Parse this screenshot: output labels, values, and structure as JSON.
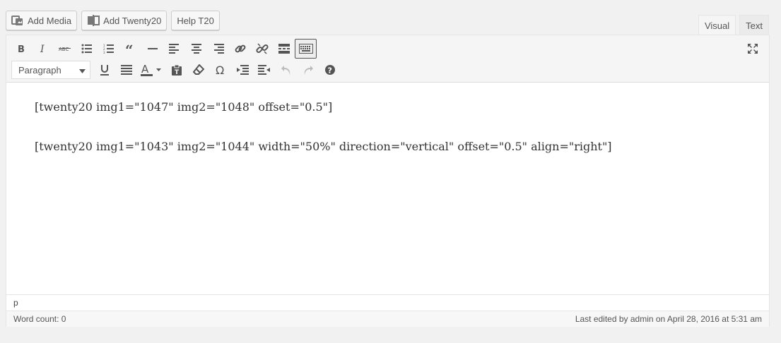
{
  "media_buttons": {
    "add_media": "Add Media",
    "add_twenty20": "Add Twenty20",
    "help_t20": "Help T20"
  },
  "tabs": {
    "visual": "Visual",
    "text": "Text"
  },
  "toolbar": {
    "row1_icons": [
      "bold-icon",
      "italic-icon",
      "strikethrough-icon",
      "bulleted-list-icon",
      "numbered-list-icon",
      "blockquote-icon",
      "horizontal-line-icon",
      "align-left-icon",
      "align-center-icon",
      "align-right-icon",
      "insert-link-icon",
      "remove-link-icon",
      "read-more-icon",
      "toolbar-toggle-icon",
      "fullscreen-icon"
    ],
    "format_select": "Paragraph",
    "row2_icons": [
      "underline-icon",
      "justify-icon",
      "text-color-icon",
      "paste-as-text-icon",
      "clear-formatting-icon",
      "special-character-icon",
      "outdent-icon",
      "indent-icon",
      "undo-icon",
      "redo-icon",
      "help-icon"
    ]
  },
  "content": {
    "line1": "[twenty20 img1=\"1047\" img2=\"1048\" offset=\"0.5\"]",
    "line2": "[twenty20 img1=\"1043\" img2=\"1044\" width=\"50%\" direction=\"vertical\" offset=\"0.5\" align=\"right\"]"
  },
  "status": {
    "path": "p"
  },
  "footer": {
    "word_count": "Word count: 0",
    "last_edited": "Last edited by admin on April 28, 2016 at 5:31 am"
  },
  "colors": {
    "background": "#f1f1f1",
    "toolbar": "#f5f5f5",
    "icon": "#555555",
    "disabled_icon": "#bbbbbb"
  }
}
